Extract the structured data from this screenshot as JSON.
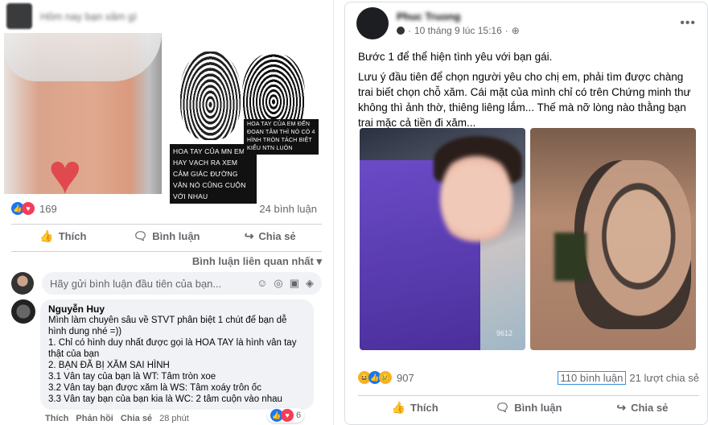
{
  "left_post": {
    "header_title": "Hôm nay bạn xăm gì",
    "image_captions": {
      "caption1": "HOA TAY CỦA MN EM HAY VẠCH RA XEM CẢM GIÁC ĐƯỜNG VÂN NÓ CŨNG CUỘN VỚI NHAU",
      "caption2": "HOA TAY CỦA EM ĐẾN ĐOẠN TÂM THÌ NÓ CÓ 4 HÌNH TRÒN TÁCH BIỆT KIỂU NTN LUÔN"
    },
    "reaction_count": "169",
    "comment_count": "24 bình luận",
    "actions": {
      "like": "Thích",
      "comment": "Bình luận",
      "share": "Chia sẻ"
    },
    "sort_label": "Bình luận liên quan nhất",
    "compose_placeholder": "Hãy gửi bình luận đầu tiên của bạn...",
    "comment": {
      "author": "Nguyễn Huy",
      "lines": [
        "Mình làm chuyên sâu về STVT phân biệt 1 chút để bạn dễ",
        "hình dung nhé =))",
        "1. Chỉ có hình duy nhất được gọi là HOA TAY là hình vân tay",
        "thật của bạn",
        "2. BẠN ĐÃ BỊ XĂM SAI HÌNH",
        "3.1 Vân tay của bạn là WT: Tâm tròn xoe",
        "3.2 Vân tay bạn được xăm là WS: Tâm xoáy trôn ốc",
        "3.3 Vân tay bạn của bạn kia là WC: 2 tâm cuộn vào nhau"
      ],
      "reaction_count": "6",
      "footer": {
        "like": "Thích",
        "reply": "Phản hồi",
        "share": "Chia sẻ",
        "time": "28 phút"
      }
    }
  },
  "right_post": {
    "author": "Phuc Truong",
    "timestamp": "10 tháng 9 lúc 15:16",
    "text_paragraphs": [
      "Bước 1 để thể hiện tình yêu với bạn gái.",
      "Lưu ý đầu tiên để chọn người yêu cho chị em, phải tìm được chàng trai biết chọn chỗ xăm. Cái mặt của mình chỉ có trên Chứng minh thư không thì ảnh thờ, thiêng liêng lắm... Thế mà nỡ lòng nào thằng bạn trai mặc cả tiền đi xăm..."
    ],
    "photo_watermark": "9612",
    "reaction_count": "907",
    "comment_count": "110 bình luận",
    "share_count": "21 lượt chia sẻ",
    "actions": {
      "like": "Thích",
      "comment": "Bình luận",
      "share": "Chia sẻ"
    }
  },
  "colors": {
    "facebook_blue": "#1877f2",
    "love_red": "#f33e58",
    "highlight_box": "#3a8dde"
  }
}
